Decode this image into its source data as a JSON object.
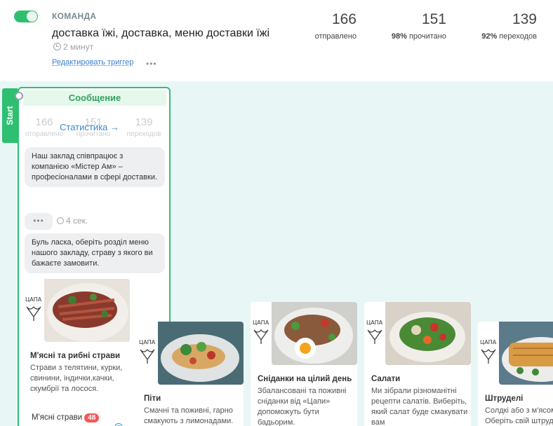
{
  "header": {
    "team_label": "КОМАНДА",
    "trigger_title": "доставка їжі, доставка, меню доставки їжі",
    "trigger_age": "2 минут",
    "edit_link": "Редактировать триггер",
    "more": "•••",
    "toggle_on": true,
    "stats": {
      "sent_num": "166",
      "sent_label": "отправлено",
      "read_num": "151",
      "read_pct": "98%",
      "read_label": " прочитано",
      "click_num": "139",
      "click_pct": "92%",
      "click_label": " переходов"
    }
  },
  "flow": {
    "start_label": "Start",
    "message": {
      "header": "Сообщение",
      "mini_stats": [
        {
          "num": "166",
          "label": "отправлено"
        },
        {
          "num": "151",
          "label": "прочитано"
        },
        {
          "num": "139",
          "label": "переходов"
        }
      ],
      "stats_link": "Статистика →",
      "bubble_1": "Наш заклад співпрацює з компанією «Містер Ам» – професіоналами в сфері доставки.",
      "typing": "•••",
      "delay": "4 сек.",
      "bubble_2": "Буль ласка, оберіть розділ меню нашого закладу, страву з якого ви бажаєте замовити."
    },
    "gallery": [
      {
        "title": "М'ясні та рибні страви",
        "desc": "Страви з телятини, курки, свинини, індички,качки, скумбрії та лосося.",
        "button": "М'ясні страви",
        "badge": "48"
      },
      {
        "title": "Піти",
        "desc": "Смачні та поживні, гарно смакують з лимонадами."
      },
      {
        "title": "Сніданки на цілий день",
        "desc": "Збалансовані та поживні сніданки від «Цапи» допоможуть бути бадьорим."
      },
      {
        "title": "Салати",
        "desc": "Ми зібрали різноманітні рецепти салатів. Виберіть, який салат буде смакувати вам"
      },
      {
        "title": "Штруделі",
        "desc": "Солдкі або з м'ясом. Оберіть свій штрудель."
      }
    ],
    "logo_text": "ЦAПA",
    "colors": {
      "accent": "#2fbf71",
      "canvas": "#e8f7f6",
      "link": "#3a7fd0",
      "badge": "#f05a5a"
    }
  }
}
